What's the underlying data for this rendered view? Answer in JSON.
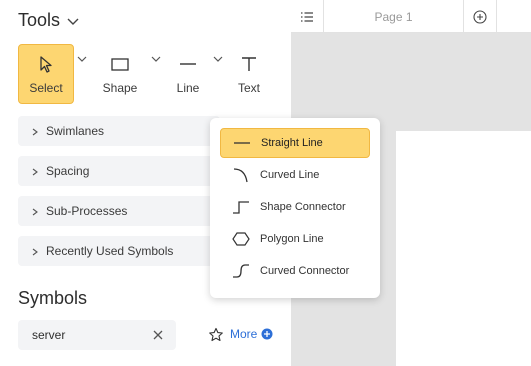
{
  "tools": {
    "title": "Tools",
    "buttons": [
      {
        "label": "Select",
        "icon": "cursor-icon"
      },
      {
        "label": "Shape",
        "icon": "rectangle-icon"
      },
      {
        "label": "Line",
        "icon": "line-icon"
      },
      {
        "label": "Text",
        "icon": "text-icon"
      }
    ]
  },
  "sections": [
    {
      "label": "Swimlanes"
    },
    {
      "label": "Spacing"
    },
    {
      "label": "Sub-Processes"
    },
    {
      "label": "Recently Used Symbols"
    }
  ],
  "symbols": {
    "title": "Symbols",
    "search_value": "server",
    "more_label": "More"
  },
  "page": {
    "tab_label": "Page 1"
  },
  "line_menu": {
    "items": [
      {
        "label": "Straight Line",
        "icon": "straight-line-icon",
        "selected": true
      },
      {
        "label": "Curved Line",
        "icon": "curved-line-icon",
        "selected": false
      },
      {
        "label": "Shape Connector",
        "icon": "shape-connector-icon",
        "selected": false
      },
      {
        "label": "Polygon Line",
        "icon": "polygon-line-icon",
        "selected": false
      },
      {
        "label": "Curved Connector",
        "icon": "curved-connector-icon",
        "selected": false
      }
    ]
  },
  "colors": {
    "accent": "#fdd671",
    "accent_border": "#f1b842",
    "link": "#2d6fd7",
    "canvas_bg": "#e3e3e3",
    "row_bg": "#f3f4f6"
  }
}
